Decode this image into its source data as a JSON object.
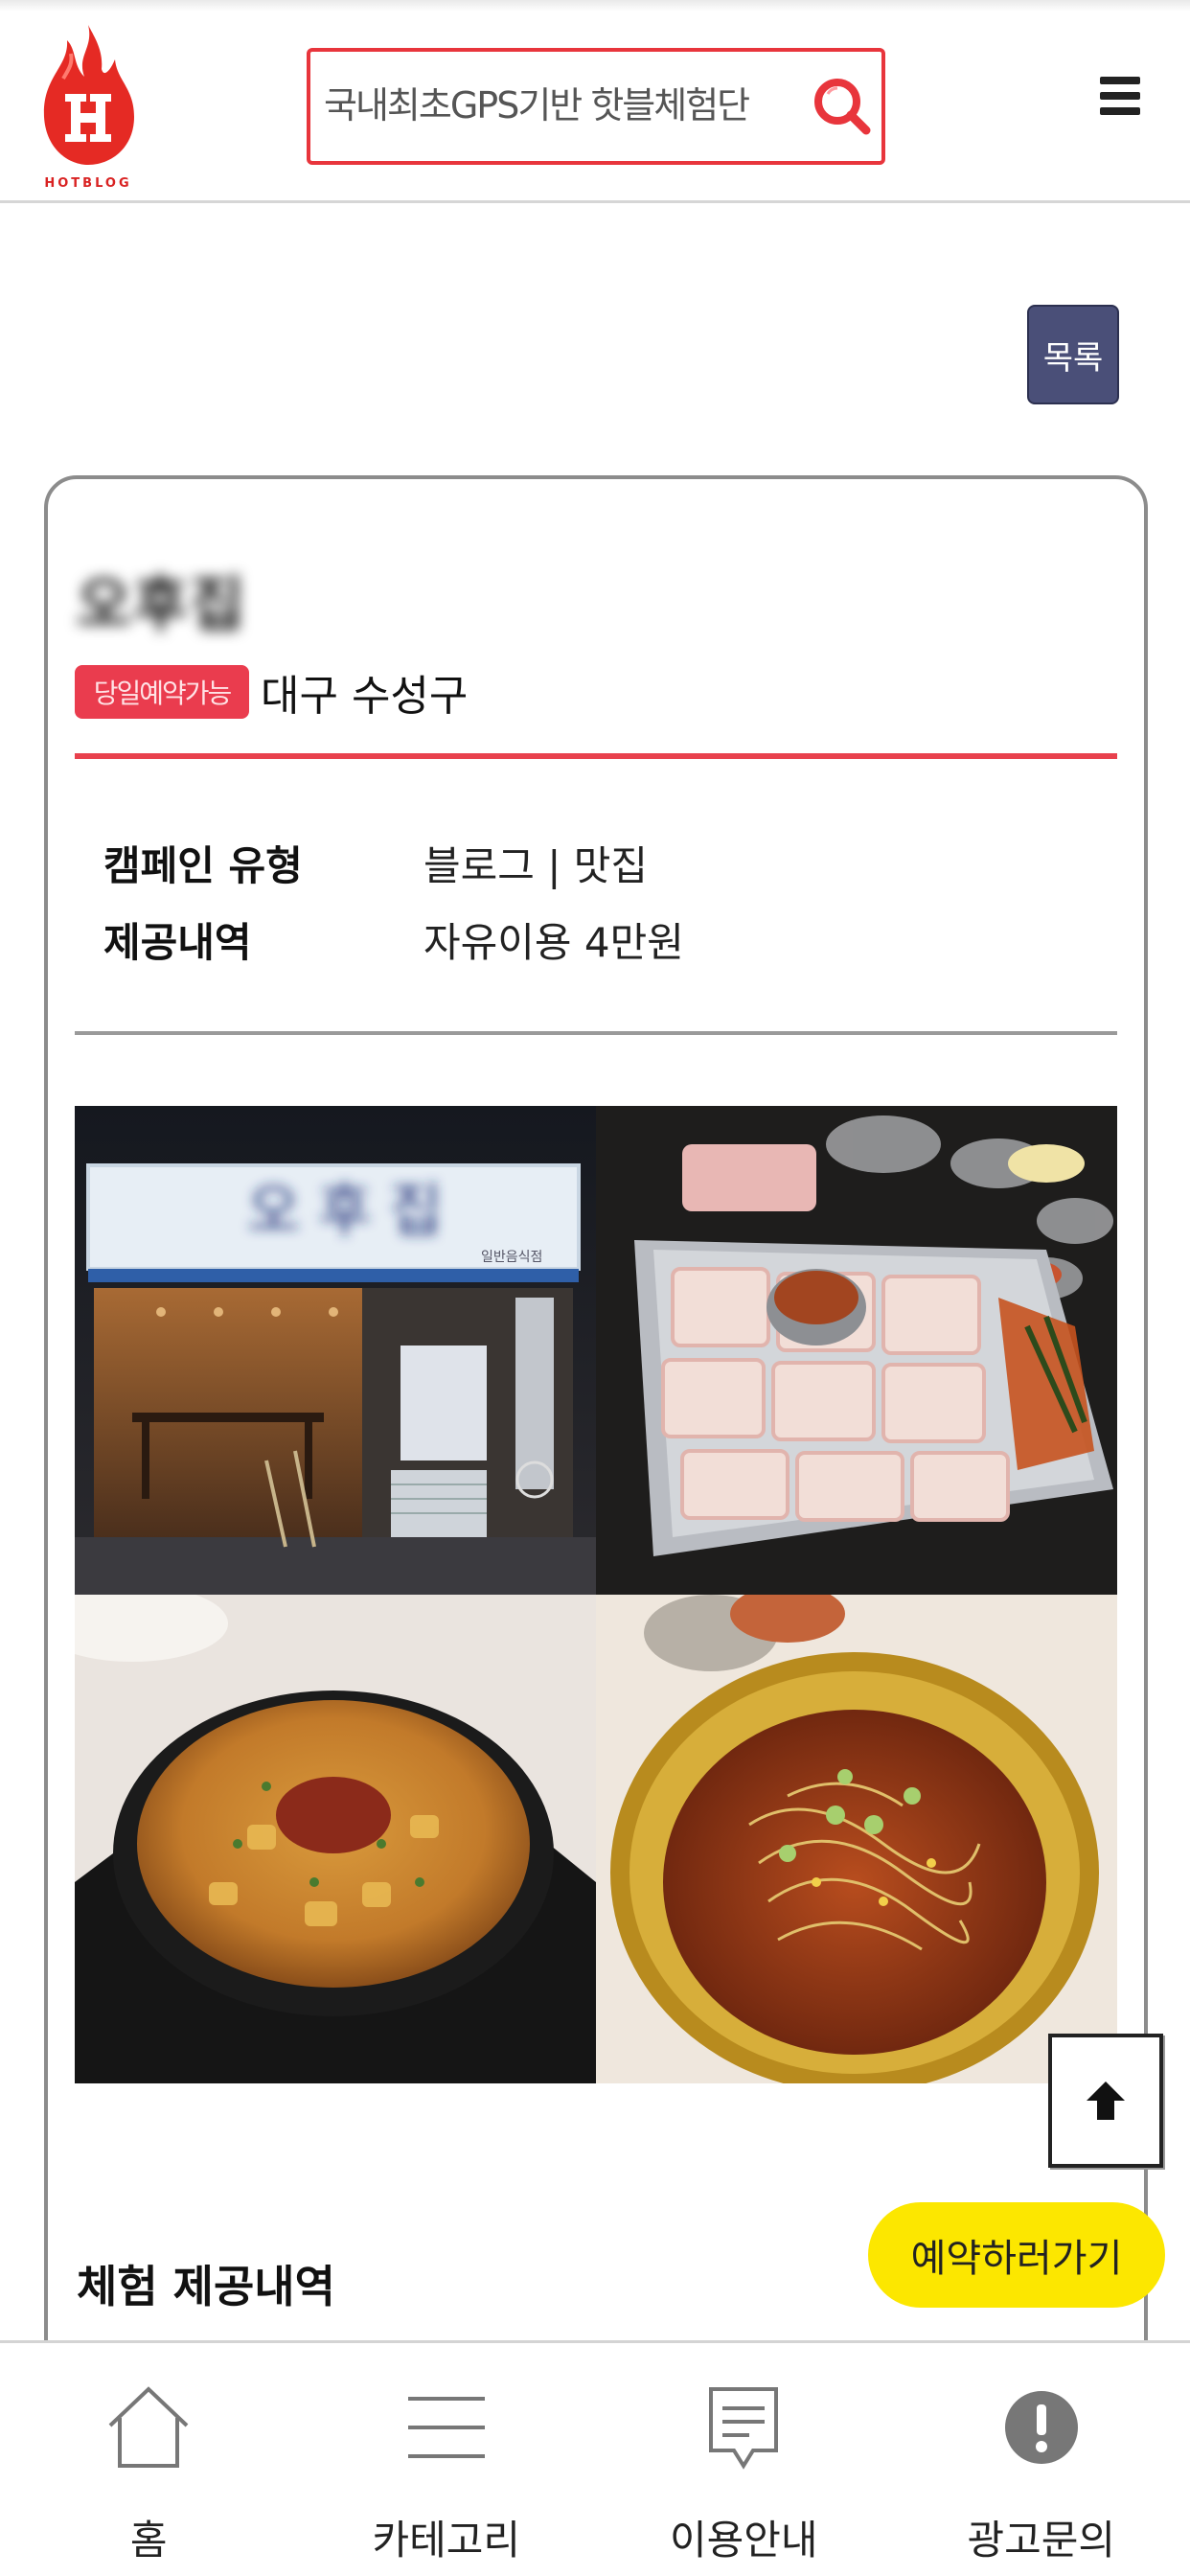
{
  "header": {
    "logo_text": "HOTBLOG",
    "search_placeholder": "국내최초GPS기반 핫블체험단",
    "colors": {
      "brand": "#e8353c",
      "logo": "#d92222"
    }
  },
  "list_button_label": "목록",
  "campaign": {
    "title": "오후집",
    "badge": "당일예약가능",
    "location": "대구 수성구",
    "info": [
      {
        "label": "캠페인 유형",
        "value": "블로그 | 맛집"
      },
      {
        "label": "제공내역",
        "value": "자유이용 4만원"
      }
    ],
    "photos": [
      {
        "icon": "restaurant-storefront-photo",
        "sign_text": "오 후 집",
        "sign_sub": "일반음식점"
      },
      {
        "icon": "grilled-pork-belly-photo"
      },
      {
        "icon": "stew-pot-photo"
      },
      {
        "icon": "ramen-pot-photo"
      }
    ],
    "section_title": "체험 제공내역"
  },
  "floating": {
    "reserve_label": "예약하러가기",
    "reserve_color": "#fce700"
  },
  "bottom_nav": [
    {
      "label": "홈",
      "icon": "home-icon"
    },
    {
      "label": "카테고리",
      "icon": "menu-icon"
    },
    {
      "label": "이용안내",
      "icon": "message-icon"
    },
    {
      "label": "광고문의",
      "icon": "alert-icon"
    }
  ]
}
